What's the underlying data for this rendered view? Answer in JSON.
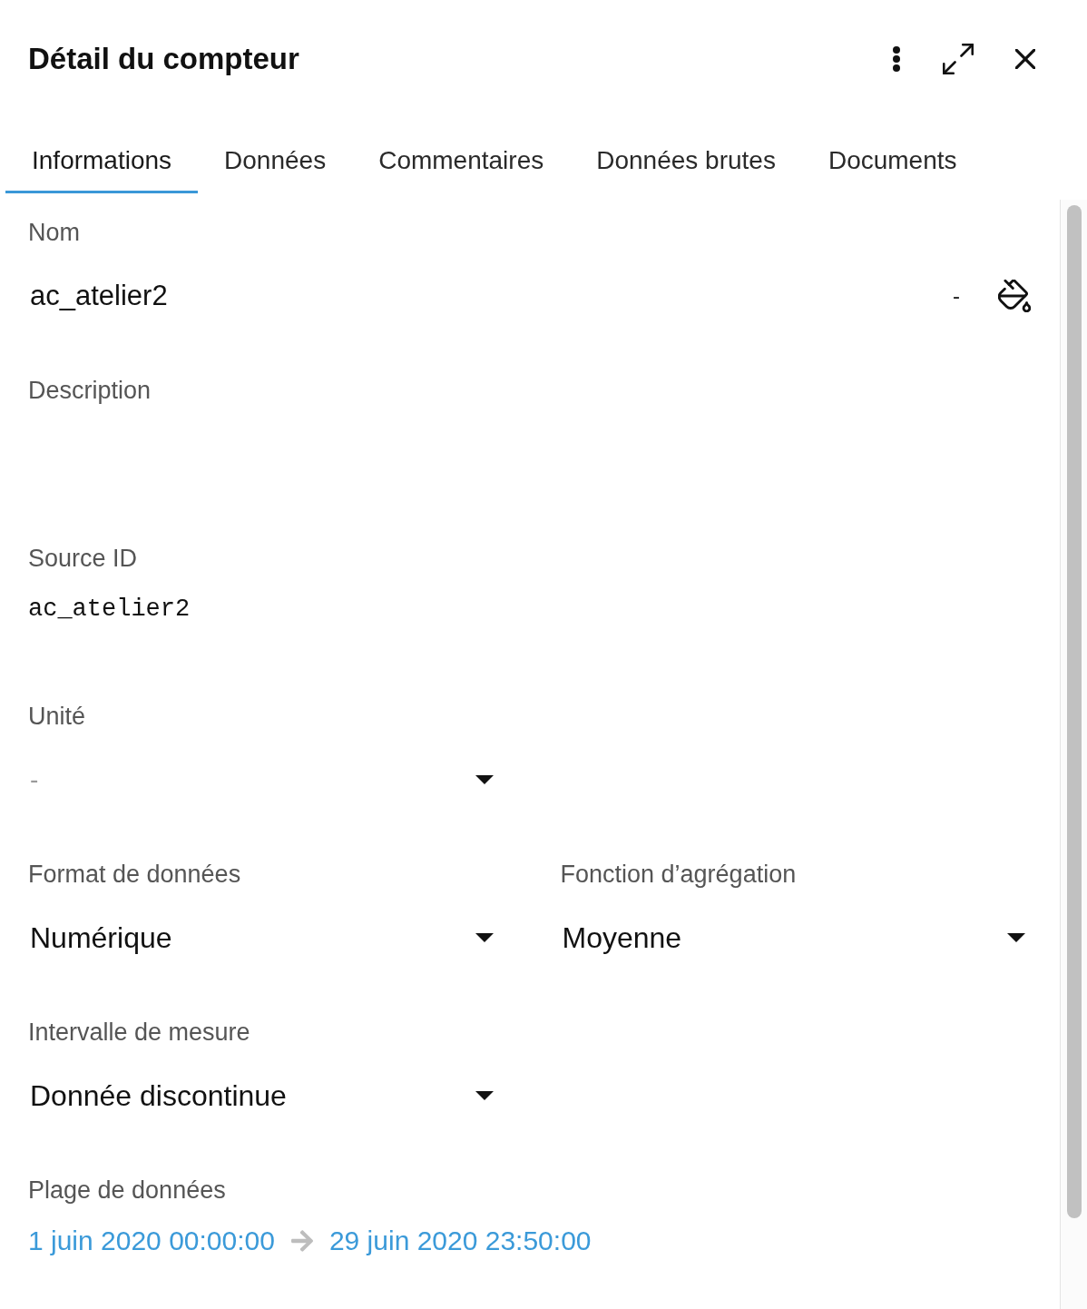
{
  "header": {
    "title": "Détail du compteur"
  },
  "tabs": [
    {
      "label": "Informations",
      "selected": true
    },
    {
      "label": "Données",
      "selected": false
    },
    {
      "label": "Commentaires",
      "selected": false
    },
    {
      "label": "Données brutes",
      "selected": false
    },
    {
      "label": "Documents",
      "selected": false
    }
  ],
  "rows": [
    [
      {
        "kind": "text",
        "label": "Nom",
        "value": "ac_atelier2",
        "color_value": "-"
      }
    ],
    [
      {
        "kind": "textarea",
        "label": "Description"
      }
    ],
    [
      {
        "kind": "code",
        "label": "Source ID",
        "value": "ac_atelier2"
      }
    ],
    [
      {
        "kind": "select",
        "label": "Unité",
        "placeholder": "-"
      }
    ],
    [
      {
        "kind": "select",
        "label": "Format de données",
        "value": "Numérique"
      },
      {
        "kind": "select",
        "label": "Fonction d’agrégation",
        "value": "Moyenne"
      }
    ],
    [
      {
        "kind": "select",
        "label": "Intervalle de mesure",
        "value": "Donnée discontinue"
      }
    ],
    [
      {
        "kind": "range",
        "label": "Plage de données",
        "start": "1 juin 2020 00:00:00",
        "end": "29 juin 2020 23:50:00"
      }
    ]
  ]
}
